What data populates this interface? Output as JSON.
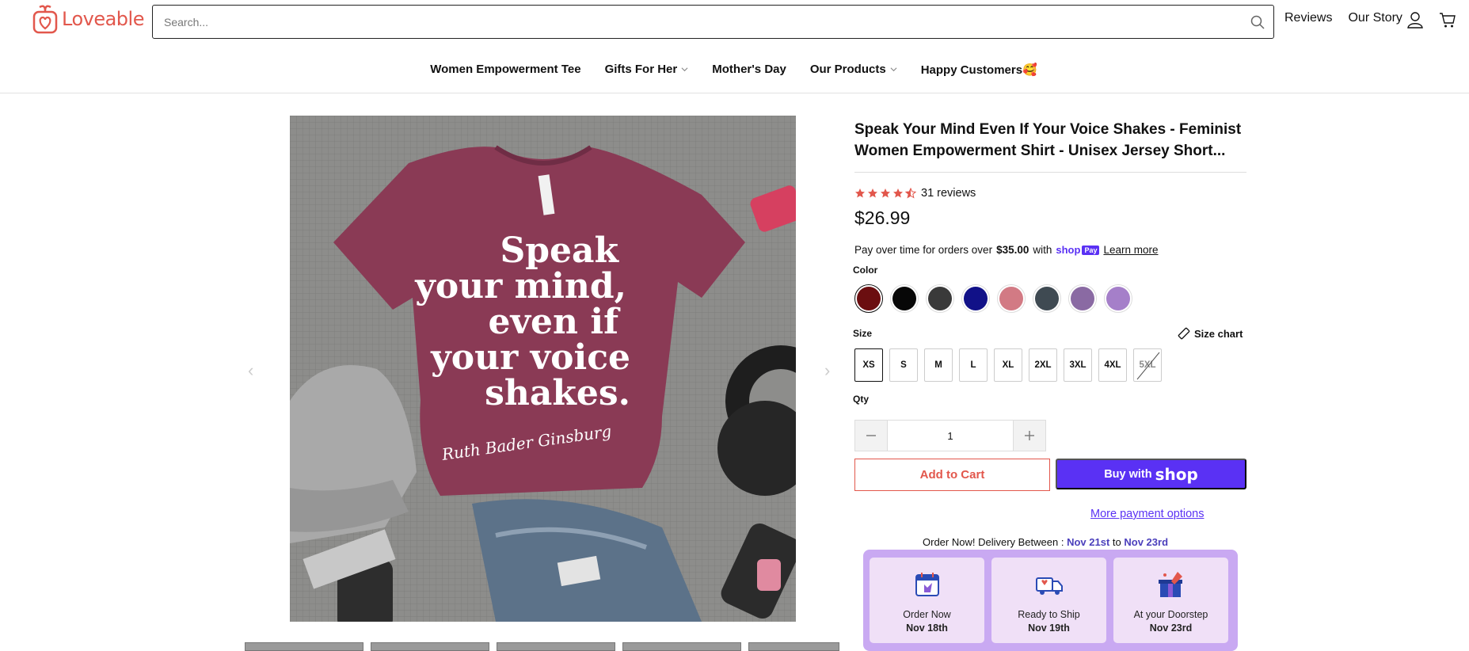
{
  "header": {
    "logo_text": "Loveable",
    "search_placeholder": "Search...",
    "links": [
      "Reviews",
      "Our Story"
    ]
  },
  "nav": {
    "items": [
      {
        "label": "Women Empowerment Tee",
        "has_dropdown": false
      },
      {
        "label": "Gifts For Her",
        "has_dropdown": true
      },
      {
        "label": "Mother's Day",
        "has_dropdown": false
      },
      {
        "label": "Our Products",
        "has_dropdown": true
      },
      {
        "label": "Happy Customers🥰",
        "has_dropdown": false
      }
    ]
  },
  "product": {
    "title": "Speak Your Mind Even If Your Voice Shakes - Feminist Women Empowerment Shirt - Unisex Jersey Short...",
    "rating": 4.5,
    "reviews_label": "31 reviews",
    "price": "$26.99",
    "image_text": {
      "quote_lines": [
        "Speak",
        "your mind,",
        "even if",
        "your voice",
        "shakes."
      ],
      "signature": "Ruth Bader Ginsburg"
    },
    "pay_over_time": {
      "prefix": "Pay over time for orders over",
      "amount": "$35.00",
      "with": "with",
      "shop_word": "shop",
      "pay_badge": "Pay",
      "learn_more": "Learn more"
    },
    "color_label": "Color",
    "colors": [
      {
        "name": "maroon",
        "hex": "#6b0e10",
        "selected": true
      },
      {
        "name": "black",
        "hex": "#070707",
        "selected": false
      },
      {
        "name": "dark-grey",
        "hex": "#3a3a3a",
        "selected": false
      },
      {
        "name": "navy",
        "hex": "#111188",
        "selected": false
      },
      {
        "name": "pink",
        "hex": "#d27a84",
        "selected": false
      },
      {
        "name": "slate",
        "hex": "#3f4a52",
        "selected": false
      },
      {
        "name": "purple",
        "hex": "#8a6aa3",
        "selected": false
      },
      {
        "name": "lilac",
        "hex": "#a57fc9",
        "selected": false
      }
    ],
    "size_label": "Size",
    "size_chart_label": "Size chart",
    "sizes": [
      {
        "label": "XS",
        "selected": true,
        "soldout": false
      },
      {
        "label": "S",
        "selected": false,
        "soldout": false
      },
      {
        "label": "M",
        "selected": false,
        "soldout": false
      },
      {
        "label": "L",
        "selected": false,
        "soldout": false
      },
      {
        "label": "XL",
        "selected": false,
        "soldout": false
      },
      {
        "label": "2XL",
        "selected": false,
        "soldout": false
      },
      {
        "label": "3XL",
        "selected": false,
        "soldout": false
      },
      {
        "label": "4XL",
        "selected": false,
        "soldout": false
      },
      {
        "label": "5XL",
        "selected": false,
        "soldout": true
      }
    ],
    "qty_label": "Qty",
    "qty_value": "1",
    "add_to_cart": "Add to Cart",
    "buy_with": "Buy with",
    "buy_shop_word": "shop",
    "more_payment": "More payment options"
  },
  "delivery": {
    "prefix": "Order Now! Delivery Between :",
    "from": "Nov 21st",
    "to_word": "to",
    "to": "Nov 23rd",
    "steps": [
      {
        "title": "Order Now",
        "date": "Nov 18th",
        "icon": "calendar-icon"
      },
      {
        "title": "Ready to Ship",
        "date": "Nov 19th",
        "icon": "truck-icon"
      },
      {
        "title": "At your Doorstep",
        "date": "Nov 23rd",
        "icon": "gift-icon"
      }
    ]
  },
  "colors": {
    "brand": "#e2574c",
    "shop_purple": "#5a31f4",
    "delivery_bg": "#c9a9f2",
    "delivery_card": "#f0e0f7",
    "star": "#e2574c"
  }
}
